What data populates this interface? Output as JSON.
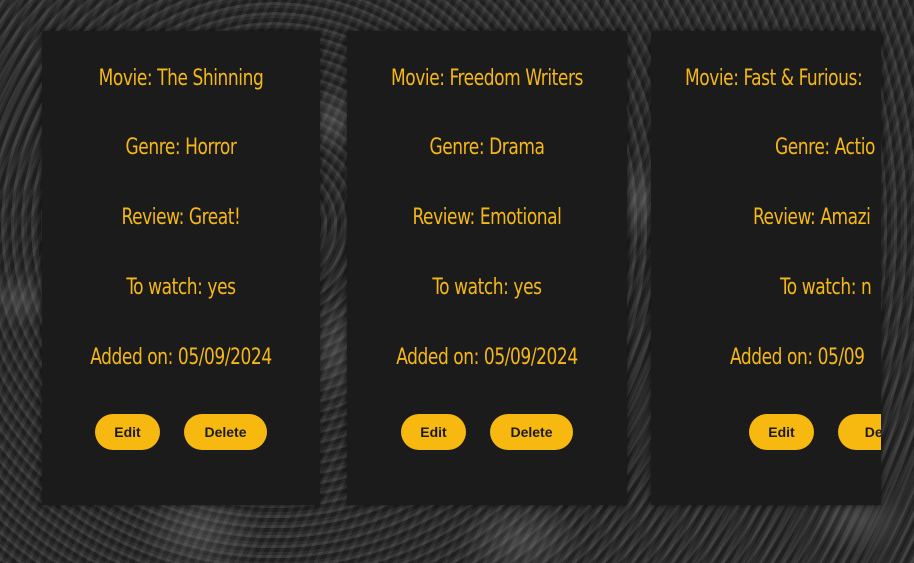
{
  "cards": [
    {
      "movie": "Movie: The Shinning",
      "genre": "Genre: Horror",
      "review": "Review: Great!",
      "to_watch": "To watch: yes",
      "added_on": "Added on: 05/09/2024",
      "edit_label": "Edit",
      "delete_label": "Delete"
    },
    {
      "movie": "Movie: Freedom Writers",
      "genre": "Genre: Drama",
      "review": "Review: Emotional",
      "to_watch": "To watch: yes",
      "added_on": "Added on: 05/09/2024",
      "edit_label": "Edit",
      "delete_label": "Delete"
    },
    {
      "movie": "Movie: Fast & Furious:",
      "genre": "Genre: Actio",
      "review": "Review: Amazi",
      "to_watch": "To watch: n",
      "added_on": "Added on: 05/09",
      "edit_label": "Edit",
      "delete_label": "Dele"
    }
  ],
  "colors": {
    "accent": "#f5b818",
    "button": "#f7b90f",
    "card": "#1b1b1b"
  }
}
